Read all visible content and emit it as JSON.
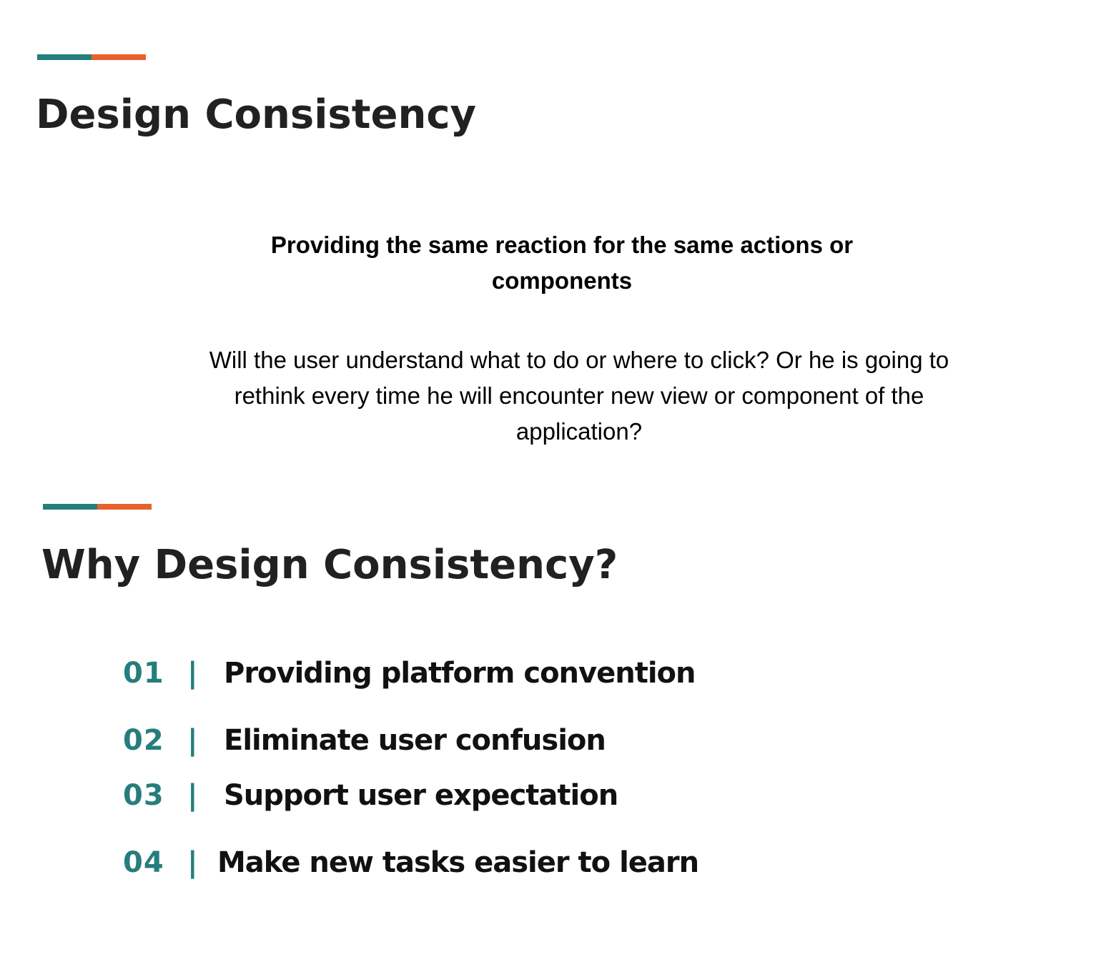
{
  "colors": {
    "accent_teal": "#267e7c",
    "accent_orange": "#e5622a",
    "heading": "#212121",
    "text": "#000000"
  },
  "section1": {
    "title": "Design Consistency",
    "subtitle": "Providing the same reaction for the same actions or components",
    "body": "Will the user understand what to do or where to click? Or he is going to rethink every time he will encounter new view or component of the application?"
  },
  "section2": {
    "title": "Why Design Consistency?",
    "separator": "|",
    "items": [
      {
        "number": "01",
        "text": "Providing platform convention"
      },
      {
        "number": "02",
        "text": "Eliminate user confusion"
      },
      {
        "number": "03",
        "text": "Support user expectation"
      },
      {
        "number": "04",
        "text": "Make new tasks easier to learn"
      }
    ]
  }
}
